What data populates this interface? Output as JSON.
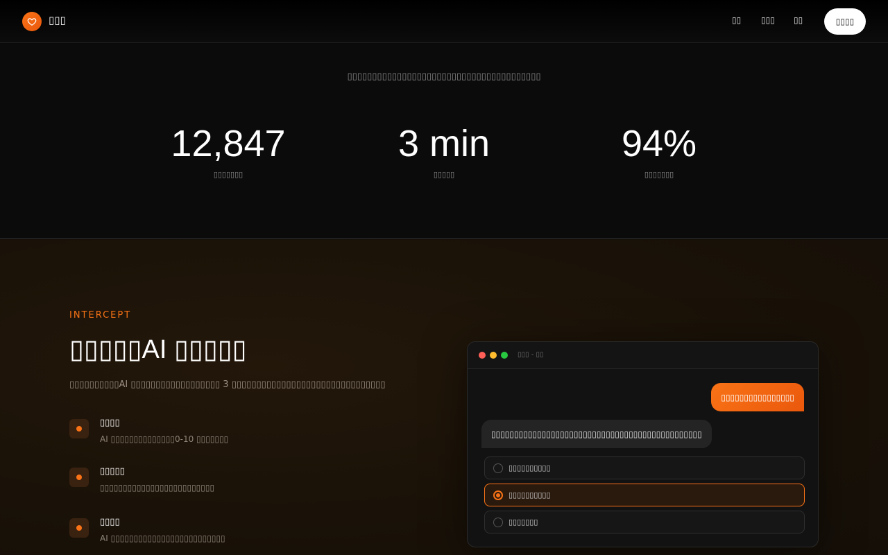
{
  "header": {
    "brand": "▯▯▯",
    "nav": [
      "▯▯",
      "▯▯▯",
      "▯▯"
    ],
    "cta_label": "▯▯▯▯",
    "brand_color": "#f97316"
  },
  "stats": {
    "tagline": "▯▯▯▯▯▯▯▯▯▯▯▯▯▯▯▯▯▯▯▯▯▯▯▯▯▯▯▯▯▯▯▯▯▯▯▯▯▯▯",
    "items": [
      {
        "value": "12,847",
        "label": "▯▯▯▯▯▯▯"
      },
      {
        "value": "3 min",
        "label": "▯▯▯▯▯"
      },
      {
        "value": "94%",
        "label": "▯▯▯▯▯▯▯"
      }
    ]
  },
  "intercept": {
    "eyebrow": "INTERCEPT",
    "title": "▯▯▯▯▯AI ▯▯▯▯▯",
    "description": "▯▯▯▯▯▯▯▯▯▯AI ▯▯▯▯▯▯▯▯▯▯▯▯▯▯▯▯▯▯ 3 ▯▯▯▯▯▯▯▯▯▯▯▯▯▯▯▯▯▯▯▯▯▯▯▯▯▯▯▯▯▯▯",
    "features": [
      {
        "title": "▯▯▯▯",
        "description": "AI ▯▯▯▯▯▯▯▯▯▯▯▯▯▯0-10 ▯▯▯▯▯▯▯"
      },
      {
        "title": "▯▯▯▯▯",
        "description": "▯▯▯▯▯▯▯▯▯▯▯▯▯▯▯▯▯▯▯▯▯▯▯▯▯"
      },
      {
        "title": "▯▯▯▯",
        "description": "AI ▯▯▯▯▯▯▯▯▯▯▯▯▯▯▯▯▯▯▯▯▯▯▯▯▯"
      }
    ]
  },
  "mockup": {
    "window_title": "▯▯▯ - ▯▯",
    "traffic_colors": [
      "#ff5f57",
      "#febc2e",
      "#28c840"
    ],
    "user_message": "▯▯▯▯▯▯▯▯▯▯▯▯▯▯▯▯",
    "ai_message": "▯▯▯▯▯▯▯▯▯▯▯▯▯▯▯▯▯▯▯▯▯▯▯▯▯▯▯▯▯▯▯▯▯▯▯▯▯▯▯▯▯▯▯▯▯▯",
    "options": [
      {
        "label": "▯▯▯▯▯▯▯▯▯▯",
        "selected": false
      },
      {
        "label": "▯▯▯▯▯▯▯▯▯▯",
        "selected": true
      },
      {
        "label": "▯▯▯▯▯▯▯",
        "selected": false
      }
    ]
  }
}
